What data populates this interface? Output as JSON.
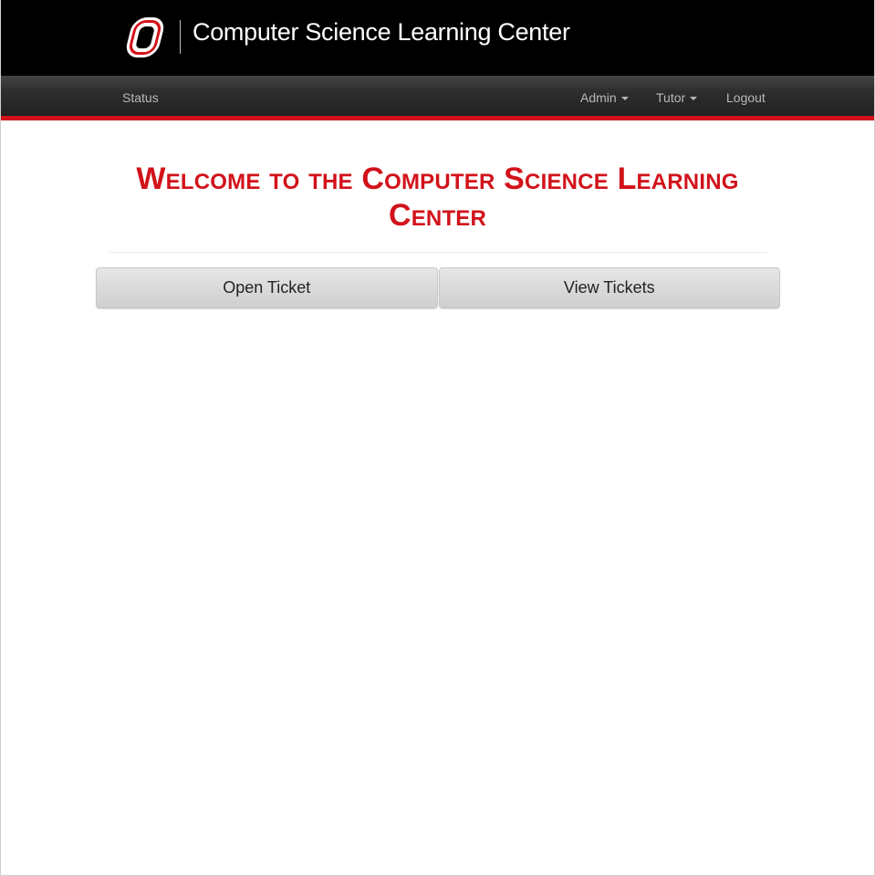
{
  "brand": {
    "title": "Computer Science Learning Center",
    "logo_icon": "uno-o-logo-icon",
    "colors": {
      "accent_red": "#d2121a",
      "header_black": "#000000",
      "nav_gray": "#2d2d2d"
    }
  },
  "navbar": {
    "left_items": [
      {
        "label": "Status"
      }
    ],
    "right_items": [
      {
        "label": "Admin",
        "has_dropdown": true
      },
      {
        "label": "Tutor",
        "has_dropdown": true
      },
      {
        "label": "Logout",
        "has_dropdown": false
      }
    ]
  },
  "main": {
    "heading": "Welcome to the Computer Science Learning Center",
    "buttons": {
      "open_ticket": "Open Ticket",
      "view_tickets": "View Tickets"
    }
  }
}
